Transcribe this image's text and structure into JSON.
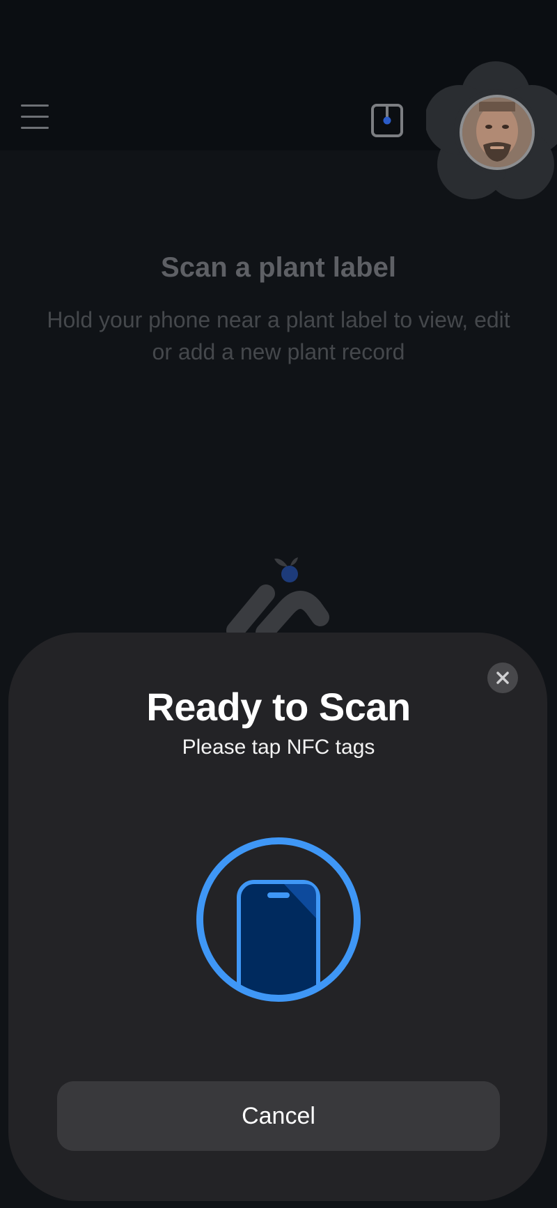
{
  "header": {
    "menu_icon": "hamburger-menu-icon",
    "nfc_icon": "nfc-scan-icon",
    "avatar_icon": "user-avatar"
  },
  "main": {
    "title": "Scan a plant label",
    "description": "Hold your phone near a plant label to view, edit or add a new plant record",
    "logo_icon": "app-logo"
  },
  "nfc_sheet": {
    "title": "Ready to Scan",
    "subtitle": "Please tap NFC tags",
    "close_icon": "close-icon",
    "graphic_icon": "phone-in-circle-icon",
    "cancel_label": "Cancel"
  },
  "colors": {
    "background": "#101317",
    "sheet": "#232326",
    "accent_blue": "#3f97f6",
    "phone_fill": "#002a5e"
  }
}
